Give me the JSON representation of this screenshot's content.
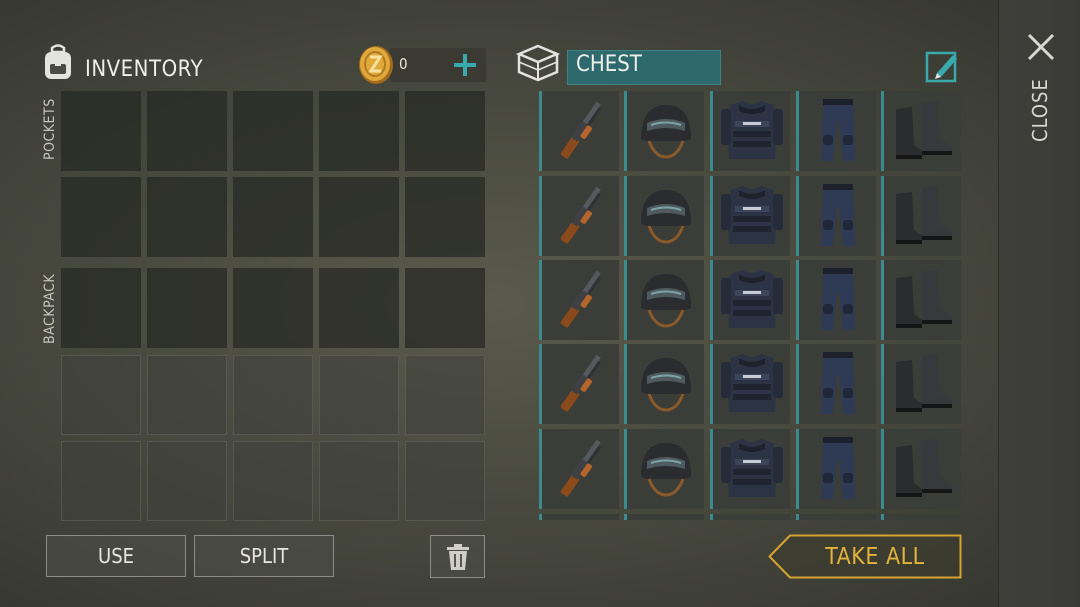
{
  "inventory": {
    "title": "INVENTORY",
    "icon": "backpack-icon",
    "coins": {
      "value": "0",
      "icon": "coin-icon",
      "add_icon": "plus-icon"
    },
    "sections": {
      "pockets": "POCKETS",
      "backpack": "BACKPACK"
    }
  },
  "chest": {
    "icon": "chest-icon",
    "name": "CHEST",
    "rename_icon": "rename-icon",
    "items": [
      [
        "shotgun-icon",
        "helmet-icon",
        "police-vest-icon",
        "pants-icon",
        "boots-icon"
      ],
      [
        "shotgun-icon",
        "helmet-icon",
        "police-vest-icon",
        "pants-icon",
        "boots-icon"
      ],
      [
        "shotgun-icon",
        "helmet-icon",
        "police-vest-icon",
        "pants-icon",
        "boots-icon"
      ],
      [
        "shotgun-icon",
        "helmet-icon",
        "police-vest-icon",
        "pants-icon",
        "boots-icon"
      ],
      [
        "shotgun-icon",
        "helmet-icon",
        "police-vest-icon",
        "pants-icon",
        "boots-icon"
      ]
    ]
  },
  "actions": {
    "use": "USE",
    "split": "SPLIT",
    "trash_icon": "trash-icon",
    "take_all": "TAKE ALL"
  },
  "close": {
    "label": "CLOSE",
    "icon": "close-icon"
  },
  "colors": {
    "accent_teal": "#2e6a6d",
    "take_all_gold": "#e3b33b",
    "slot_stripe": "#3a8a8e"
  }
}
